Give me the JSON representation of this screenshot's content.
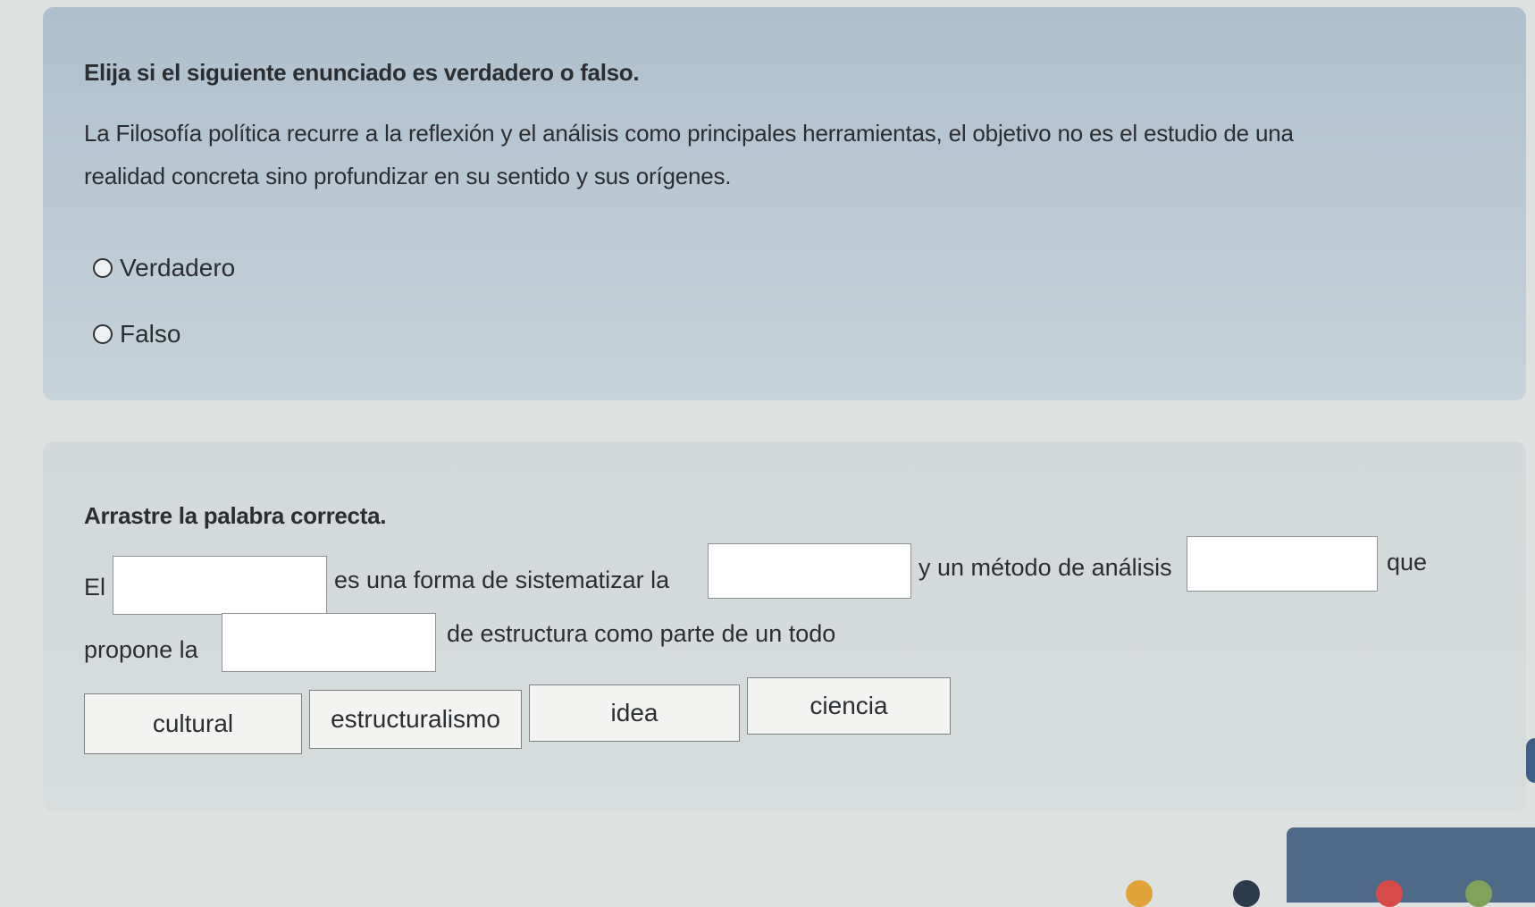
{
  "question1": {
    "title": "Elija si el siguiente enunciado es verdadero o falso.",
    "statement_line1": "La Filosofía política recurre a la reflexión y el análisis como principales herramientas, el objetivo no es el estudio de una",
    "statement_line2": "realidad concreta sino profundizar en su sentido y sus orígenes.",
    "options": [
      "Verdadero",
      "Falso"
    ]
  },
  "question2": {
    "title": "Arrastre la palabra correcta.",
    "fragments": {
      "el": "El",
      "f1": "es una forma de sistematizar la",
      "f2": "y un método de análisis",
      "f3": "que",
      "propone": "propone la",
      "f4": "de estructura como parte de un todo"
    },
    "word_bank": [
      "cultural",
      "estructuralismo",
      "idea",
      "ciencia"
    ]
  },
  "colors": {
    "card1_bg": "#b4c4d0",
    "card2_bg": "#d5dbdb",
    "bottom_tab": "#4f6a89"
  }
}
